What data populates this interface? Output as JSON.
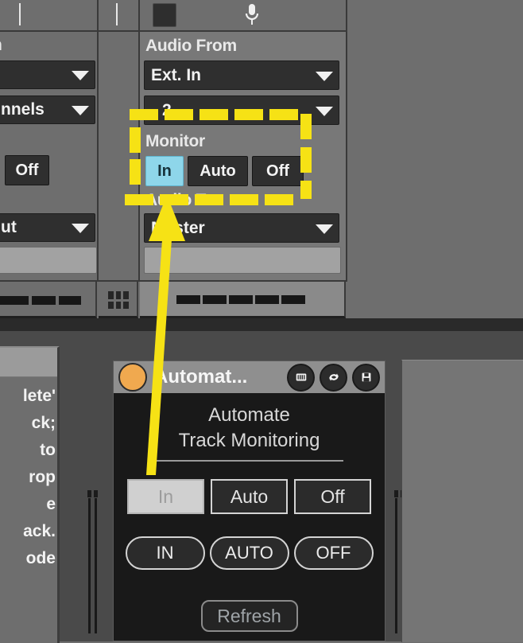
{
  "app": {
    "background_color": "#6e6e6e",
    "annotation_color": "#f6e215"
  },
  "live_mixer": {
    "left_track_column": {
      "truncated_label": "n",
      "chooser_1_value": "",
      "chooser_2_value": "nnels",
      "monitor_value": "Off",
      "output_chooser_value": "ut"
    },
    "selected_track_column": {
      "audio_from_label": "Audio From",
      "audio_from_value": "Ext. In",
      "input_channel_value": "2",
      "monitor_label": "Monitor",
      "monitor_options": [
        "In",
        "Auto",
        "Off"
      ],
      "monitor_selected": "In",
      "audio_to_label": "Audio To",
      "audio_to_value": "Master",
      "audio_to_sub_value": ""
    },
    "top_row": {
      "record_button": "",
      "mic_icon": "microphone-icon"
    },
    "device_strip": {
      "grid_icon": "grid-3x3-icon"
    }
  },
  "info_panel": {
    "lines": [
      "lete'",
      "ck;",
      "to",
      "rop",
      "e",
      "ack.",
      "ode"
    ]
  },
  "device_window": {
    "title": "Automat...",
    "status_dot_color": "#f0a94f",
    "icons": [
      "patcher-icon",
      "refresh-icon",
      "save-icon"
    ],
    "heading_line_1": "Automate",
    "heading_line_2": "Track Monitoring",
    "square_buttons": [
      {
        "label": "In",
        "selected": true
      },
      {
        "label": "Auto",
        "selected": false
      },
      {
        "label": "Off",
        "selected": false
      }
    ],
    "pill_buttons": [
      "IN",
      "AUTO",
      "OFF"
    ],
    "refresh_label": "Refresh"
  }
}
